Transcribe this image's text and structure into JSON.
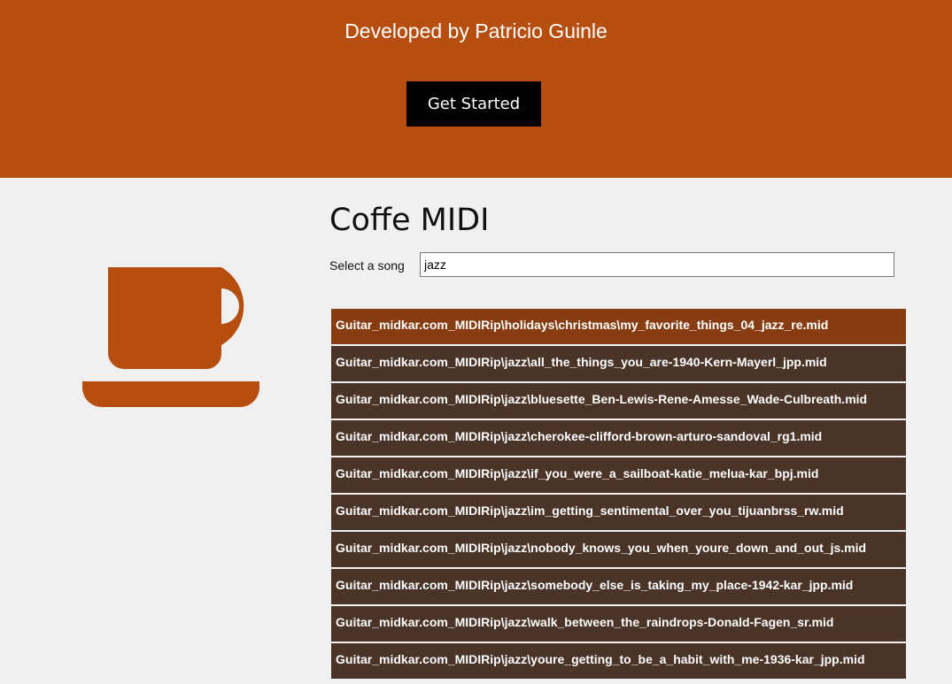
{
  "hero": {
    "credit": "Developed by Patricio Guinle",
    "cta_label": "Get Started"
  },
  "colors": {
    "brand": "#b54e0f",
    "list_item": "#4a3327",
    "list_item_active": "#873d11"
  },
  "logo": {
    "icon": "coffee-cup-icon"
  },
  "main": {
    "title": "Coffe MIDI",
    "search": {
      "label": "Select a song",
      "value": "jazz"
    },
    "results": [
      "Guitar_midkar.com_MIDIRip\\holidays\\christmas\\my_favorite_things_04_jazz_re.mid",
      "Guitar_midkar.com_MIDIRip\\jazz\\all_the_things_you_are-1940-Kern-Mayerl_jpp.mid",
      "Guitar_midkar.com_MIDIRip\\jazz\\bluesette_Ben-Lewis-Rene-Amesse_Wade-Culbreath.mid",
      "Guitar_midkar.com_MIDIRip\\jazz\\cherokee-clifford-brown-arturo-sandoval_rg1.mid",
      "Guitar_midkar.com_MIDIRip\\jazz\\if_you_were_a_sailboat-katie_melua-kar_bpj.mid",
      "Guitar_midkar.com_MIDIRip\\jazz\\im_getting_sentimental_over_you_tijuanbrss_rw.mid",
      "Guitar_midkar.com_MIDIRip\\jazz\\nobody_knows_you_when_youre_down_and_out_js.mid",
      "Guitar_midkar.com_MIDIRip\\jazz\\somebody_else_is_taking_my_place-1942-kar_jpp.mid",
      "Guitar_midkar.com_MIDIRip\\jazz\\walk_between_the_raindrops-Donald-Fagen_sr.mid",
      "Guitar_midkar.com_MIDIRip\\jazz\\youre_getting_to_be_a_habit_with_me-1936-kar_jpp.mid"
    ]
  }
}
